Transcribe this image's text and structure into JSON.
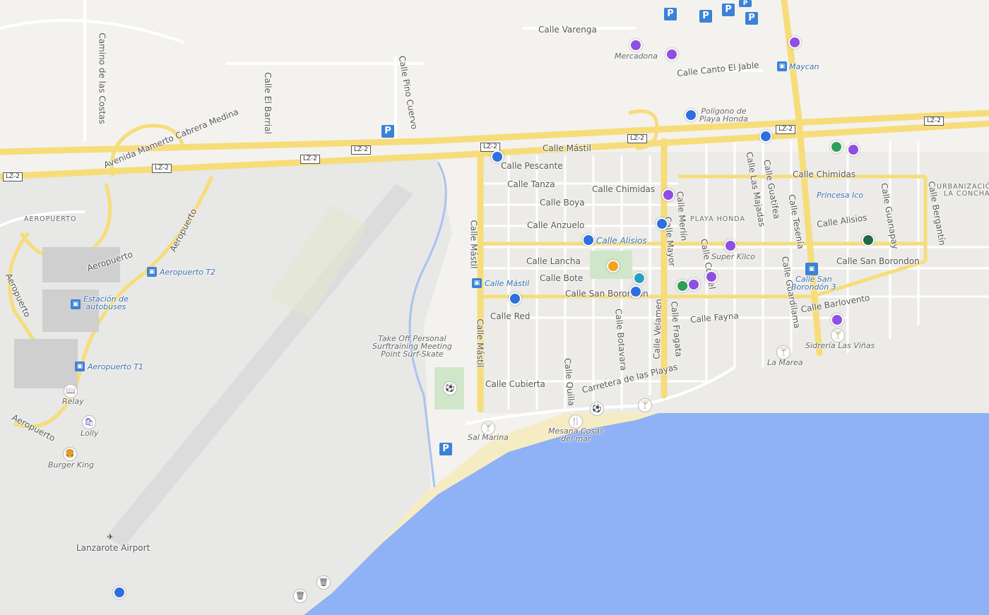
{
  "colors": {
    "land": "#f4f2ee",
    "sea": "#8fb1f5",
    "beach": "#f6ecc4",
    "major_road": "#f6dd7a",
    "minor_road": "#ffffff",
    "airport": "#e6e6e6",
    "marker_blue": "#2f6fe0",
    "marker_purple": "#8f4fe0",
    "marker_green": "#2ea05a",
    "marker_darkgreen": "#1f6b45",
    "marker_orange": "#f5a020",
    "marker_teal": "#2a9fc0"
  },
  "road_shields": [
    "LZ-2",
    "LZ-2",
    "LZ-2",
    "LZ-2",
    "LZ-2",
    "LZ-2",
    "LZ-2",
    "LZ-2"
  ],
  "streets": [
    "Calle Varenga",
    "Calle Canto El Jable",
    "Camino de las Costas",
    "Calle El Barrial",
    "Calle Pino Cuervo",
    "Avenida Mamerto Cabrera Medina",
    "Calle Mástil",
    "Calle Pescante",
    "Calle Tanza",
    "Calle Boya",
    "Calle Anzuelo",
    "Calle Chimidas",
    "Calle Chimidas",
    "Calle Alisios",
    "Calle Alisios",
    "Calle Lancha",
    "Calle Bote",
    "Calle Mástil",
    "Calle San Borondon",
    "Calle San Borondon",
    "Calle Red",
    "Calle Mástil",
    "Calle Cubierta",
    "Calle Quilla",
    "Carretera de las Playas",
    "Calle Botavara",
    "Calle Velamen",
    "Calle Fragata",
    "Calle Fayna",
    "Calle Barlovento",
    "Calle Mayor",
    "Calle Merlín",
    "Calle Cordel",
    "Calle Las Majadas",
    "Calle Guatifea",
    "Calle Tesenía",
    "Calle Guardilama",
    "Calle Guanapay",
    "Calle Bergantín",
    "Aeropuerto",
    "Aeropuerto",
    "Aeropuerto",
    "Aeropuerto"
  ],
  "areas": [
    "AEROPUERTO",
    "PLAYA HONDA",
    "URBANIZACIÓN\nLA CONCHA"
  ],
  "pois": [
    "Mercadona",
    "Polígono de\nPlaya Honda",
    "Princesa Ico",
    "Super Kilco",
    "Sidrería Las Viñas",
    "La Marea",
    "Mesana Cosas\ndel mar",
    "Sal Marina",
    "Take Off Personal\nSurftraining Meeting\nPoint Surf-Skate",
    "Relay",
    "Lolly",
    "Burger King",
    "Lanzarote Airport"
  ],
  "transit": [
    "Maycan",
    "Aeropuerto T2",
    "Estación de\nautobuses",
    "Aeropuerto T1",
    "Calle Mástil",
    "Calle San\nBorondón 3"
  ],
  "parking_label": "P",
  "markers": [
    {
      "color": "purple"
    },
    {
      "color": "purple"
    },
    {
      "color": "purple"
    },
    {
      "color": "blue"
    },
    {
      "color": "blue"
    },
    {
      "color": "green"
    },
    {
      "color": "purple"
    },
    {
      "color": "blue"
    },
    {
      "color": "purple"
    },
    {
      "color": "blue"
    },
    {
      "color": "blue"
    },
    {
      "color": "purple"
    },
    {
      "color": "darkgreen"
    },
    {
      "color": "orange"
    },
    {
      "color": "teal"
    },
    {
      "color": "blue"
    },
    {
      "color": "green"
    },
    {
      "color": "purple"
    },
    {
      "color": "purple"
    },
    {
      "color": "blue"
    },
    {
      "color": "purple"
    },
    {
      "color": "blue"
    }
  ]
}
